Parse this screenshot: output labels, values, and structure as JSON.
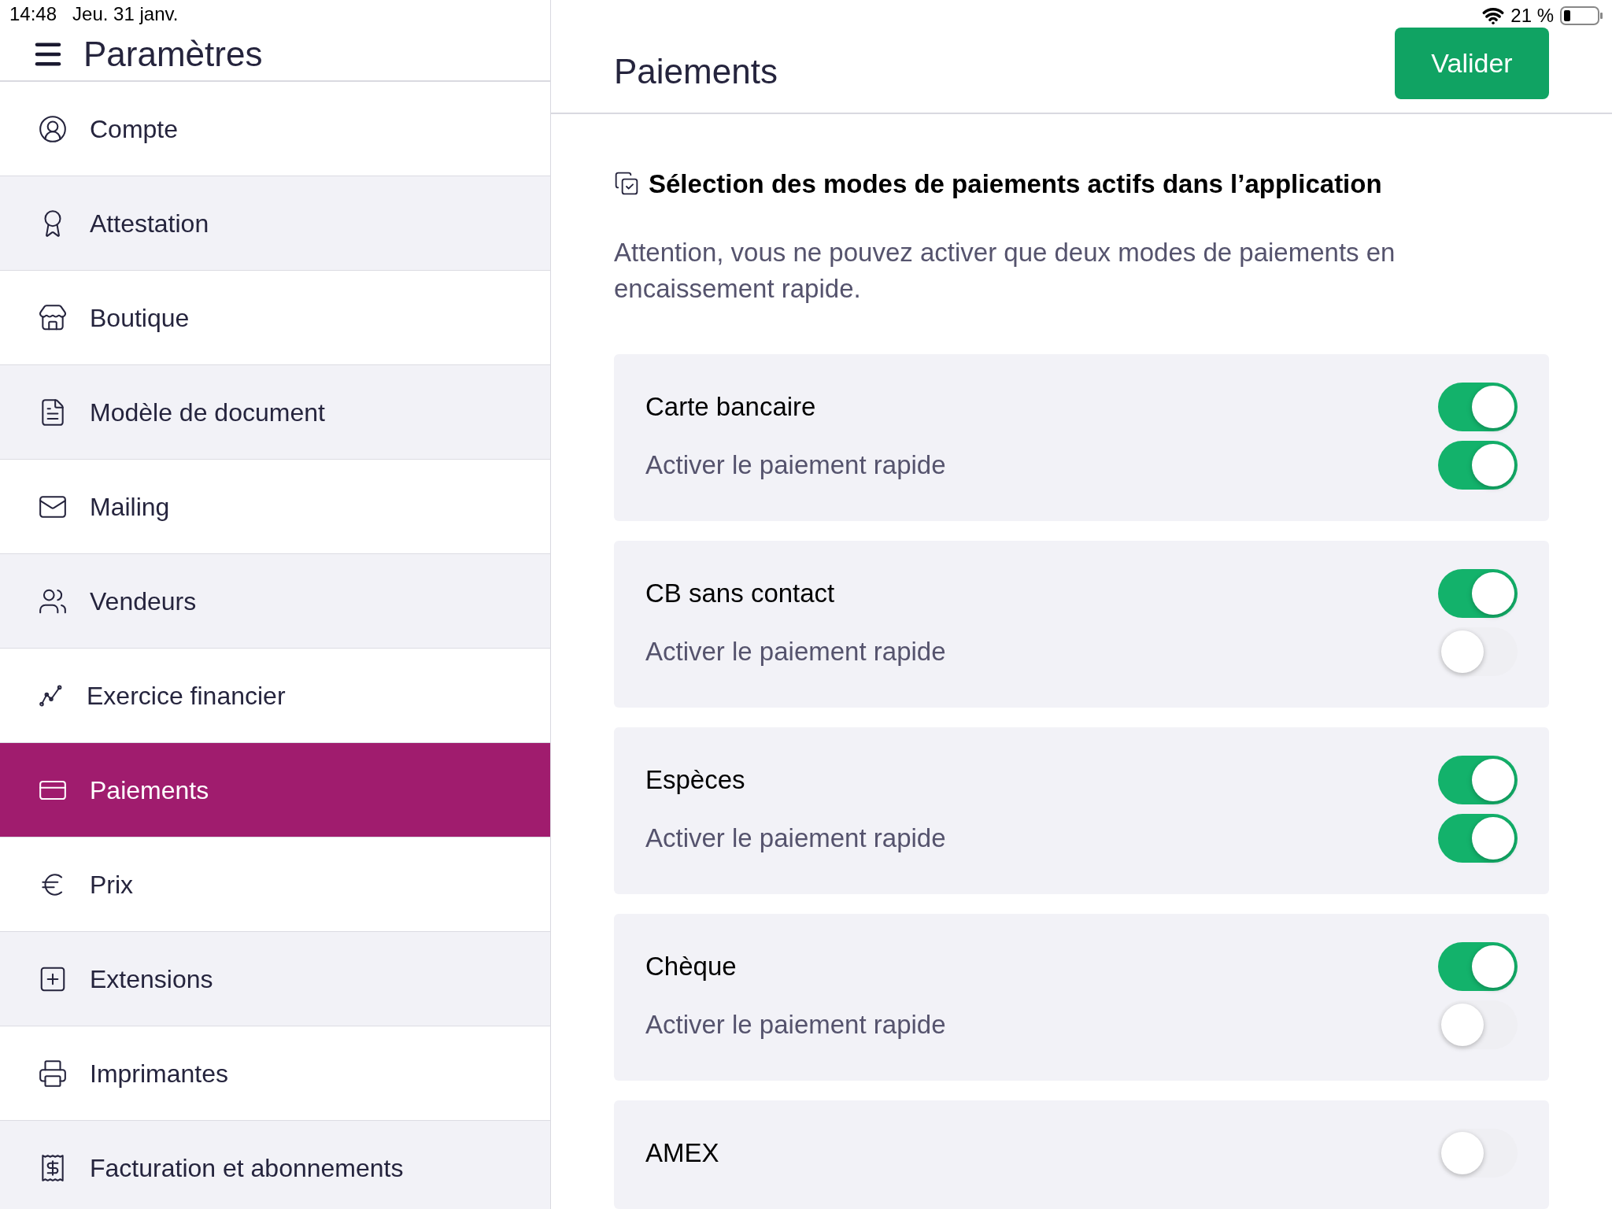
{
  "status_bar": {
    "time": "14:48",
    "date": "Jeu. 31 janv.",
    "battery": "21 %"
  },
  "sidebar": {
    "title": "Paramètres",
    "items": [
      {
        "label": "Compte",
        "selected": false
      },
      {
        "label": "Attestation",
        "selected": false
      },
      {
        "label": "Boutique",
        "selected": false
      },
      {
        "label": "Modèle de document",
        "selected": false
      },
      {
        "label": "Mailing",
        "selected": false
      },
      {
        "label": "Vendeurs",
        "selected": false
      },
      {
        "label": "Exercice financier",
        "selected": false
      },
      {
        "label": "Paiements",
        "selected": true
      },
      {
        "label": "Prix",
        "selected": false
      },
      {
        "label": "Extensions",
        "selected": false
      },
      {
        "label": "Imprimantes",
        "selected": false
      },
      {
        "label": "Facturation et abonnements",
        "selected": false
      }
    ]
  },
  "main": {
    "title": "Paiements",
    "validate_button": "Valider",
    "section_title": "Sélection des modes de paiements actifs dans l’application",
    "notice": "Attention, vous ne pouvez activer que deux modes de paiements en encaissement rapide.",
    "methods": [
      {
        "name": "Carte bancaire",
        "on": true,
        "quick_label": "Activer le paiement rapide",
        "quick_on": true
      },
      {
        "name": "CB sans contact",
        "on": true,
        "quick_label": "Activer le paiement rapide",
        "quick_on": false
      },
      {
        "name": "Espèces",
        "on": true,
        "quick_label": "Activer le paiement rapide",
        "quick_on": true
      },
      {
        "name": "Chèque",
        "on": true,
        "quick_label": "Activer le paiement rapide",
        "quick_on": false
      },
      {
        "name": "AMEX",
        "on": false
      }
    ]
  }
}
